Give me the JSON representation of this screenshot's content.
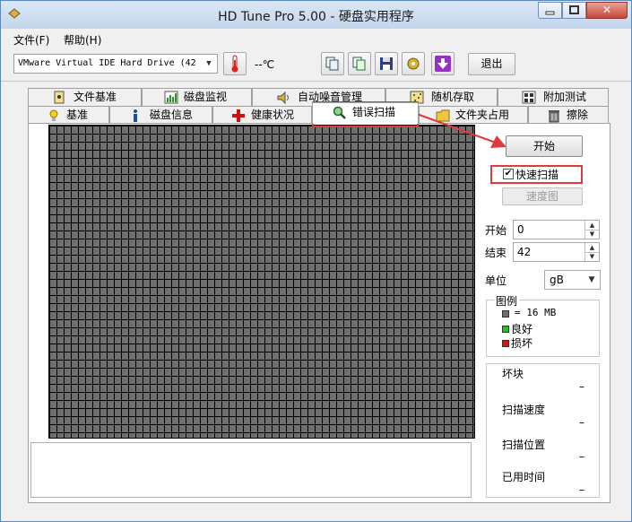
{
  "window": {
    "title": "HD Tune Pro 5.00 - 硬盘实用程序",
    "close_glyph": "✕"
  },
  "menu": {
    "file": "文件(F)",
    "help": "帮助(H)"
  },
  "toolbar": {
    "drive": "VMware Virtual IDE Hard Drive (42",
    "temperature": "--℃",
    "exit_label": "退出"
  },
  "tabs_row1": [
    {
      "label": "文件基准",
      "icon": "file-benchmark-icon"
    },
    {
      "label": "磁盘监视",
      "icon": "disk-monitor-icon"
    },
    {
      "label": "自动噪音管理",
      "icon": "speaker-icon"
    },
    {
      "label": "随机存取",
      "icon": "random-access-icon"
    },
    {
      "label": "附加测试",
      "icon": "extra-tests-icon"
    }
  ],
  "tabs_row2": [
    {
      "label": "基准",
      "icon": "benchmark-icon"
    },
    {
      "label": "磁盘信息",
      "icon": "info-icon"
    },
    {
      "label": "健康状况",
      "icon": "health-cross-icon"
    },
    {
      "label": "错误扫描",
      "icon": "magnifier-icon",
      "active": true
    },
    {
      "label": "文件夹占用",
      "icon": "folder-icon"
    },
    {
      "label": "擦除",
      "icon": "trash-icon"
    }
  ],
  "scan": {
    "start_button": "开始",
    "quick_scan_label": "快速扫描",
    "quick_scan_checked": true,
    "speed_map_button": "速度图",
    "start_label": "开始",
    "start_value": "0",
    "end_label": "结束",
    "end_value": "42",
    "unit_label": "单位",
    "unit_value": "gB"
  },
  "legend": {
    "title": "图例",
    "block_size": "= 16 MB",
    "good": "良好",
    "bad": "损坏",
    "colors": {
      "block": "#6e6e6e",
      "good": "#22c022",
      "bad": "#e01010"
    }
  },
  "stats": {
    "bad_blocks_label": "坏块",
    "bad_blocks_value": "–",
    "scan_speed_label": "扫描速度",
    "scan_speed_value": "–",
    "scan_position_label": "扫描位置",
    "scan_position_value": "–",
    "elapsed_label": "已用时间",
    "elapsed_value": "–"
  },
  "colors": {
    "annotation_red": "#e03a3a",
    "grid_block": "#6e6e6e"
  }
}
